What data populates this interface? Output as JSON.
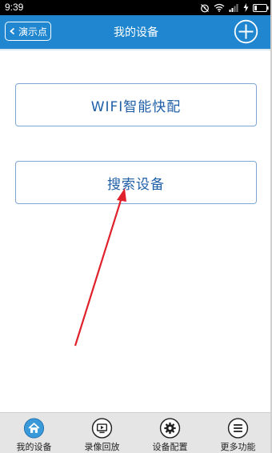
{
  "status_bar": {
    "time": "9:39"
  },
  "header": {
    "back_label": "演示点",
    "title": "我的设备"
  },
  "main": {
    "wifi_button_label": "WIFI智能快配",
    "search_button_label": "搜索设备"
  },
  "bottom_nav": {
    "items": [
      {
        "label": "我的设备",
        "icon": "home-icon",
        "active": true
      },
      {
        "label": "录像回放",
        "icon": "play-screen-icon",
        "active": false
      },
      {
        "label": "设备配置",
        "icon": "gear-icon",
        "active": false
      },
      {
        "label": "更多功能",
        "icon": "menu-icon",
        "active": false
      }
    ]
  },
  "colors": {
    "header": "#1f86cf",
    "button_border": "#7ea7d6",
    "button_text": "#1f5fa8",
    "arrow": "#e0202a"
  }
}
